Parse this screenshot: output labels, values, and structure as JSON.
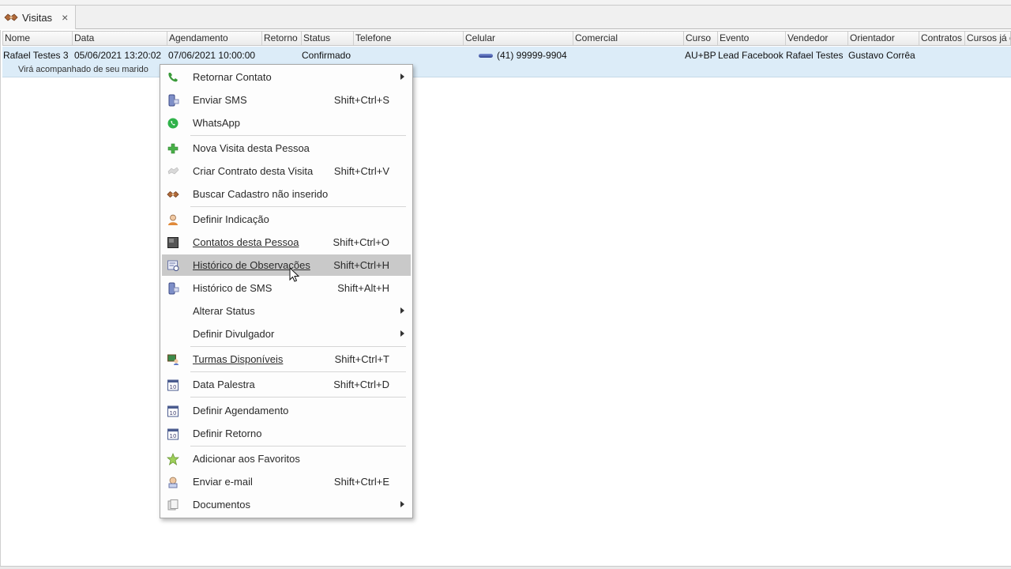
{
  "tab": {
    "label": "Visitas",
    "close": "×"
  },
  "grid": {
    "columns": [
      "Nome",
      "Data",
      "Agendamento",
      "Retorno",
      "Status",
      "Telefone",
      "Celular",
      "Comercial",
      "Curso",
      "Evento",
      "Vendedor",
      "Orientador",
      "Contratos",
      "Cursos já c"
    ],
    "row": {
      "nome": "Rafael Testes 3",
      "data": "05/06/2021 13:20:02",
      "agendamento": "07/06/2021 10:00:00",
      "retorno": "",
      "status": "Confirmado",
      "telefone": "",
      "celular": "(41) 99999-9904",
      "comercial": "",
      "curso": "AU+BP",
      "evento": "Lead Facebook",
      "vendedor": "Rafael Testes",
      "orientador": "Gustavo Corrêa",
      "contratos": "",
      "cursos_ja": "",
      "preview": "Virá acompanhado de seu marido"
    }
  },
  "menu": {
    "items": [
      {
        "label": "Retornar Contato",
        "shortcut": "",
        "icon": "phone-icon"
      },
      {
        "label": "Enviar SMS",
        "shortcut": "Shift+Ctrl+S",
        "icon": "sms-icon"
      },
      {
        "label": "WhatsApp",
        "shortcut": "",
        "icon": "whatsapp-icon"
      },
      {
        "label": "Nova Visita desta Pessoa",
        "shortcut": "",
        "icon": "add-icon"
      },
      {
        "label": "Criar Contrato desta Visita",
        "shortcut": "Shift+Ctrl+V",
        "icon": "contract-icon"
      },
      {
        "label": "Buscar Cadastro não inserido",
        "shortcut": "",
        "icon": "handshake-icon"
      },
      {
        "label": "Definir Indicação",
        "shortcut": "",
        "icon": "person-icon"
      },
      {
        "label": "Contatos desta Pessoa",
        "shortcut": "Shift+Ctrl+O",
        "icon": "contacts-icon"
      },
      {
        "label": "Histórico de Observações",
        "shortcut": "Shift+Ctrl+H",
        "icon": "history-icon"
      },
      {
        "label": "Histórico de SMS",
        "shortcut": "Shift+Alt+H",
        "icon": "sms-history-icon"
      },
      {
        "label": "Alterar Status",
        "shortcut": "",
        "icon": ""
      },
      {
        "label": "Definir Divulgador",
        "shortcut": "",
        "icon": ""
      },
      {
        "label": "Turmas Disponíveis",
        "shortcut": "Shift+Ctrl+T",
        "icon": "classes-icon"
      },
      {
        "label": "Data Palestra",
        "shortcut": "Shift+Ctrl+D",
        "icon": "calendar-icon"
      },
      {
        "label": "Definir Agendamento",
        "shortcut": "",
        "icon": "calendar-icon"
      },
      {
        "label": "Definir Retorno",
        "shortcut": "",
        "icon": "calendar-icon"
      },
      {
        "label": "Adicionar aos Favoritos",
        "shortcut": "",
        "icon": "star-icon"
      },
      {
        "label": "Enviar e-mail",
        "shortcut": "Shift+Ctrl+E",
        "icon": "email-icon"
      },
      {
        "label": "Documentos",
        "shortcut": "",
        "icon": "documents-icon"
      }
    ]
  },
  "colors": {
    "selection": "#dcecf8",
    "menu_highlight": "#c9c9c9",
    "calendar_digits": "10"
  }
}
